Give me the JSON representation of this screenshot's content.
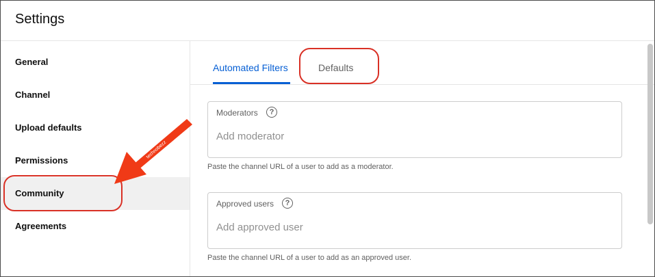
{
  "header": {
    "title": "Settings"
  },
  "sidebar": {
    "items": [
      {
        "label": "General"
      },
      {
        "label": "Channel"
      },
      {
        "label": "Upload defaults"
      },
      {
        "label": "Permissions"
      },
      {
        "label": "Community",
        "selected": true
      },
      {
        "label": "Agreements"
      }
    ]
  },
  "tabs": [
    {
      "label": "Automated Filters",
      "selected": true
    },
    {
      "label": "Defaults"
    }
  ],
  "fields": {
    "moderators": {
      "label": "Moderators",
      "placeholder": "Add moderator",
      "hint": "Paste the channel URL of a user to add as a moderator."
    },
    "approved_users": {
      "label": "Approved users",
      "placeholder": "Add approved user",
      "hint": "Paste the channel URL of a user to add as an approved user."
    }
  },
  "help_icon_glyph": "?",
  "watermark": "technobezz",
  "colors": {
    "accent": "#065fd4",
    "annotation": "#d93025",
    "arrow": "#f03a17"
  }
}
